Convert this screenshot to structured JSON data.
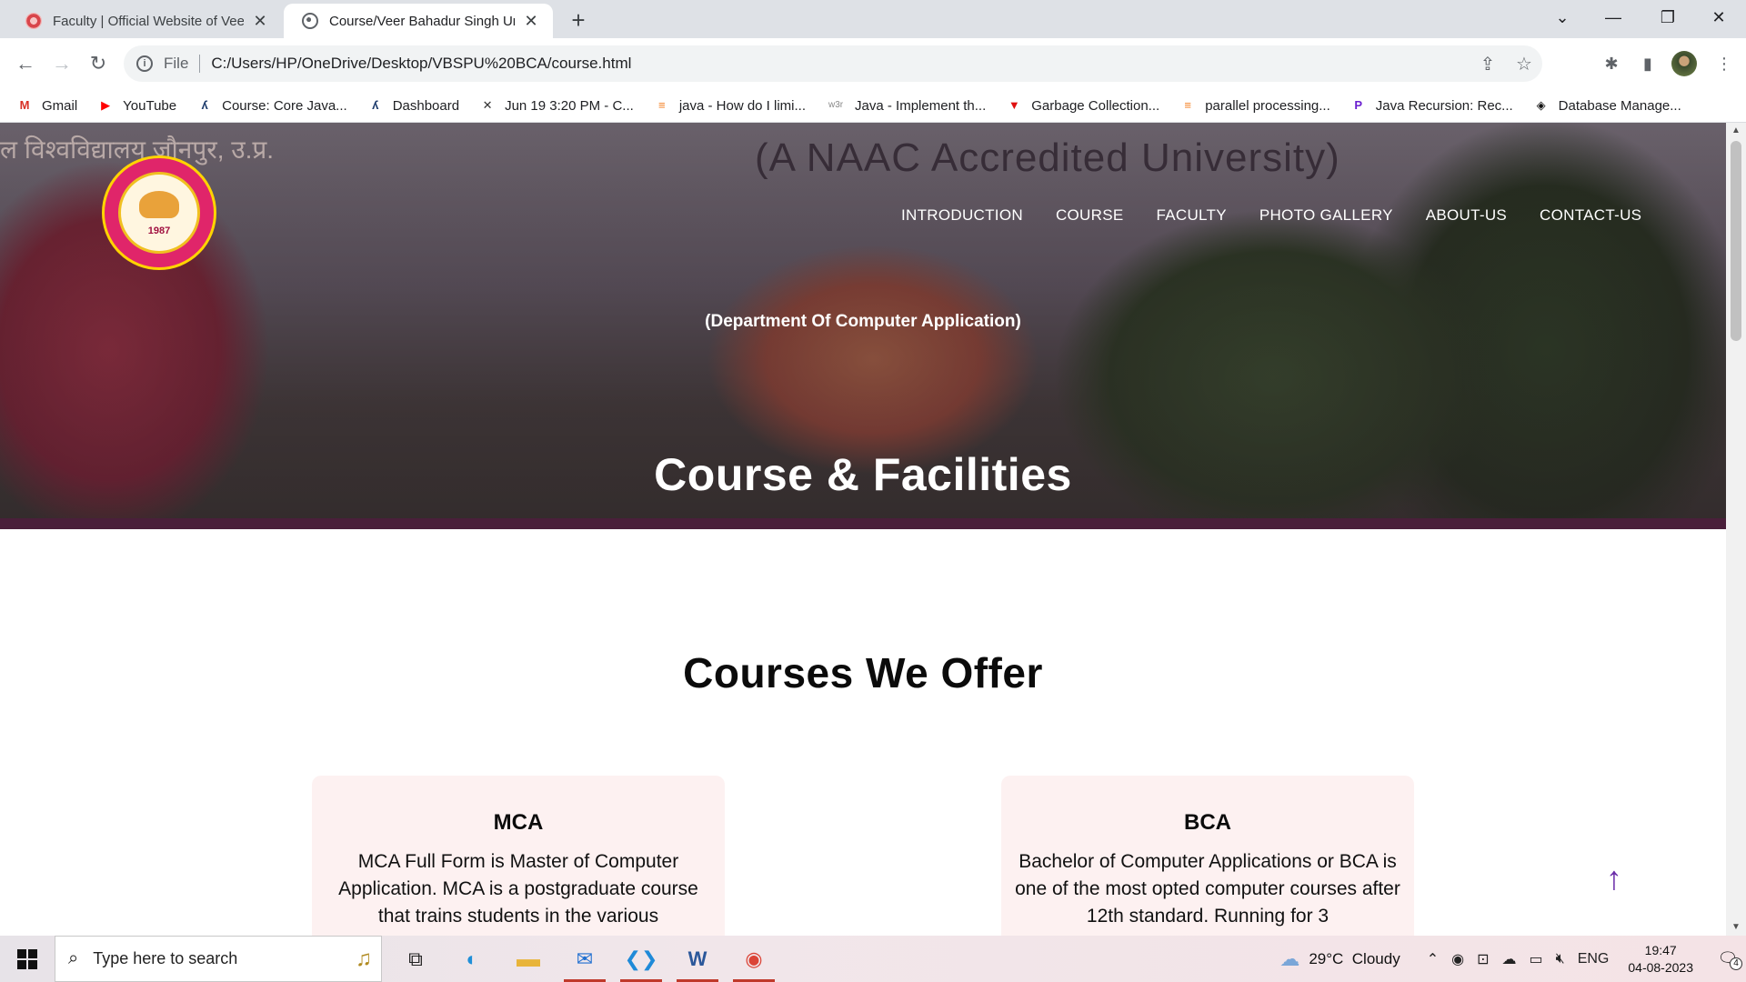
{
  "browser": {
    "tabs": [
      {
        "title": "Faculty | Official Website of Veer Bahadur Singh",
        "close": "✕"
      },
      {
        "title": "Course/Veer Bahadur Singh University",
        "close": "✕"
      }
    ],
    "new_tab": "+",
    "window_controls": {
      "dropdown": "⌄",
      "minimize": "—",
      "restore": "❐",
      "close": "✕"
    },
    "nav": {
      "back": "←",
      "forward": "→",
      "reload": "↻"
    },
    "address": {
      "info": "i",
      "scheme": "File",
      "url": "C:/Users/HP/OneDrive/Desktop/VBSPU%20BCA/course.html",
      "share": "⇪",
      "star": "☆"
    },
    "toolbar_icons": {
      "extensions": "✱",
      "sidepanel": "▮",
      "menu": "⋮"
    },
    "bookmarks": [
      {
        "label": "Gmail",
        "icon": "gmail-icon",
        "glyph": "M",
        "color": "#d93025"
      },
      {
        "label": "YouTube",
        "icon": "youtube-icon",
        "glyph": "▶",
        "color": "#ff0000"
      },
      {
        "label": "Course: Core Java...",
        "icon": "course-icon",
        "glyph": "ʎ",
        "color": "#1b3a6b"
      },
      {
        "label": "Dashboard",
        "icon": "dashboard-icon",
        "glyph": "ʎ",
        "color": "#1b3a6b"
      },
      {
        "label": "Jun 19 3:20 PM - C...",
        "icon": "calendar-icon",
        "glyph": "✕",
        "color": "#333333"
      },
      {
        "label": "java - How do I limi...",
        "icon": "stackoverflow-icon",
        "glyph": "≡",
        "color": "#f48024"
      },
      {
        "label": "Java - Implement th...",
        "icon": "w3r-icon",
        "glyph": "w3r",
        "color": "#888888"
      },
      {
        "label": "Garbage Collection...",
        "icon": "garbage-icon",
        "glyph": "▼",
        "color": "#e01010"
      },
      {
        "label": "parallel processing...",
        "icon": "stackoverflow-icon",
        "glyph": "≡",
        "color": "#f48024"
      },
      {
        "label": "Java Recursion: Rec...",
        "icon": "recursion-icon",
        "glyph": "P",
        "color": "#6a1fd0"
      },
      {
        "label": "Database Manage...",
        "icon": "database-icon",
        "glyph": "◈",
        "color": "#111111"
      }
    ]
  },
  "hero": {
    "hindi_text": "ल विश्वविद्यालय जौनपुर, उ.प्र.",
    "naac": "(A NAAC Accredited University)",
    "nav": [
      {
        "label": "INTRODUCTION"
      },
      {
        "label": "COURSE"
      },
      {
        "label": "FACULTY"
      },
      {
        "label": "PHOTO GALLERY"
      },
      {
        "label": "ABOUT-US"
      },
      {
        "label": "CONTACT-US"
      }
    ],
    "department": "(Department Of Computer Application)",
    "title": "Course & Facilities"
  },
  "courses": {
    "heading": "Courses We Offer",
    "items": [
      {
        "title": "MCA",
        "body": "MCA Full Form is Master of Computer Application. MCA is a postgraduate course that trains students in the various"
      },
      {
        "title": "BCA",
        "body": "Bachelor of Computer Applications or BCA is one of the most opted computer courses after 12th standard. Running for 3"
      }
    ]
  },
  "back_to_top": "↑",
  "scroll": {
    "up": "▲",
    "down": "▼"
  },
  "taskbar": {
    "search_placeholder": "Type here to search",
    "search_icon": "⌕",
    "trumpet": "♫",
    "apps": [
      {
        "name": "task-view-icon",
        "glyph": "⧉",
        "color": "#222222"
      },
      {
        "name": "edge-icon",
        "glyph": "◐",
        "color": "#1f8fd8"
      },
      {
        "name": "file-explorer-icon",
        "glyph": "▬",
        "color": "#e8b43a"
      },
      {
        "name": "mail-icon",
        "glyph": "✉",
        "color": "#1f6fd0"
      },
      {
        "name": "vscode-icon",
        "glyph": "❮❯",
        "color": "#1f8ad8"
      },
      {
        "name": "word-icon",
        "glyph": "W",
        "color": "#2b579a"
      },
      {
        "name": "chrome-icon",
        "glyph": "◉",
        "color": "#db4437"
      }
    ],
    "weather": {
      "temp": "29°C",
      "condition": "Cloudy"
    },
    "tray_icons": [
      "⌃",
      "◉",
      "⊡",
      "☁",
      "▭",
      "🔇︎"
    ],
    "lang": "ENG",
    "time": "19:47",
    "date": "04-08-2023",
    "notifications": "4"
  },
  "colors": {
    "accent_purple": "#6a2ca8",
    "card_bg": "#fdf1f1",
    "logo_pink": "#e0256a",
    "logo_gold": "#ffd400"
  }
}
